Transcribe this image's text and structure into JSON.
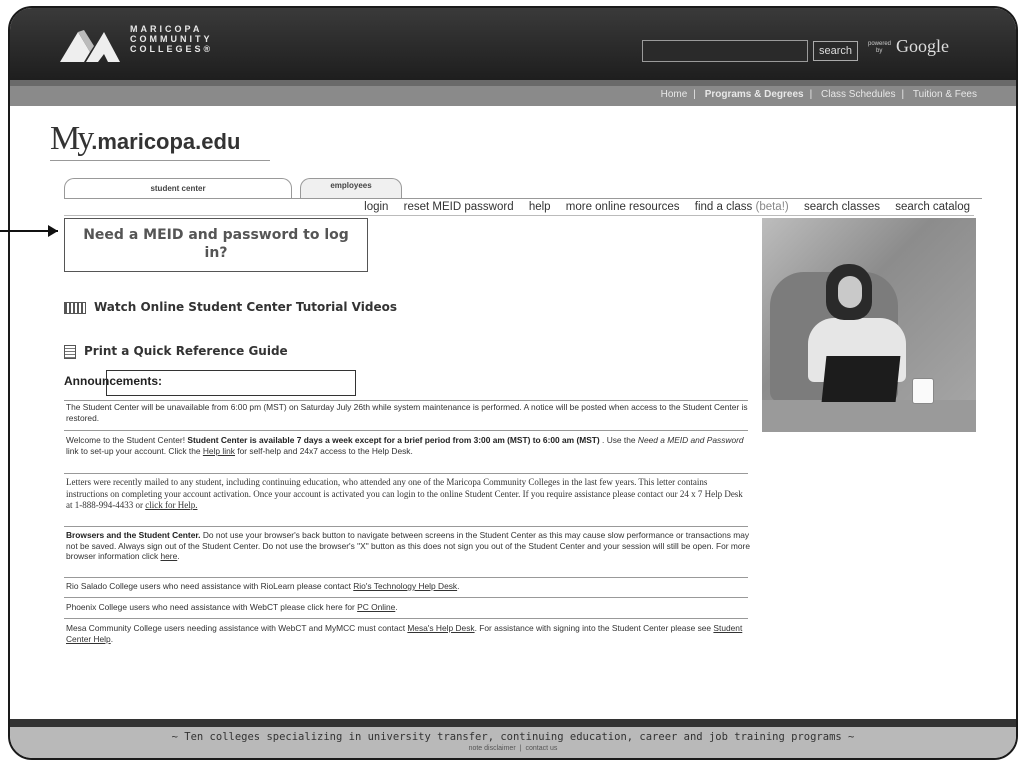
{
  "header": {
    "logo_lines": [
      "MARICOPA",
      "COMMUNITY",
      "COLLEGES®"
    ],
    "search_button": "search",
    "powered_by": [
      "powered",
      "by"
    ],
    "google": "Google"
  },
  "nav": {
    "items": [
      {
        "label": "Home",
        "bold": false
      },
      {
        "label": "Programs & Degrees",
        "bold": true
      },
      {
        "label": "Class Schedules",
        "bold": false
      },
      {
        "label": "Tuition & Fees",
        "bold": false
      }
    ],
    "separator": "|"
  },
  "brand": {
    "my": "My",
    "domain": ".maricopa.edu"
  },
  "tabs": {
    "student": "student center",
    "employees": "employees"
  },
  "sublinks": {
    "login": "login",
    "reset": "reset MEID password",
    "help": "help",
    "resources": "more online resources",
    "find_class": "find a class",
    "beta": "(beta!)",
    "search_classes": "search classes",
    "search_catalog": "search catalog"
  },
  "meid": {
    "line1": "Need a MEID and password to log",
    "line2": "in?"
  },
  "links": {
    "videos": "Watch Online Student Center Tutorial Videos",
    "guide": "Print a Quick Reference Guide"
  },
  "announcements": {
    "title": "Announcements:",
    "a1": "The Student Center will be unavailable from 6:00 pm (MST) on Saturday July 26th while system maintenance is performed.  A notice will be posted when access to the Student Center is restored.",
    "a2_pre": "Welcome to the Student Center! ",
    "a2_bold": "Student Center is available 7 days a week except for a brief period from 3:00 am (MST) to 6:00 am (MST)",
    "a2_mid": " . Use the ",
    "a2_italic": "Need a MEID and Password",
    "a2_mid2": " link to set-up your account. Click the ",
    "a2_link": "Help link",
    "a2_end": " for self-help and 24x7 access to the Help Desk.",
    "a3": "Letters were recently mailed to any student, including continuing education, who attended any one of the Maricopa Community Colleges in the last few years. This letter contains instructions on completing your account activation. Once your account is activated you can login to the online Student Center.  If you require assistance please contact our 24 x 7 Help Desk at 1-888-994-4433 or ",
    "a3_link": "click for Help.",
    "a4_bold": "Browsers and the Student Center.",
    "a4": " Do not use your browser's back button to navigate between screens in the Student Center as this may cause slow performance or transactions may not be saved.  Always sign out of the Student Center. Do not use the browser's \"X\" button as this does not sign you out of the Student Center and your session will still be open. For more browser information click ",
    "a4_link": "here",
    "a4_end": ".",
    "a5": "Rio Salado College users who need assistance with RioLearn please contact ",
    "a5_link": "Rio's Technology Help Desk",
    "a5_end": ".",
    "a6": "Phoenix College users who need assistance with WebCT please click here for ",
    "a6_link": "PC Online",
    "a6_end": ".",
    "a7": "Mesa Community College users needing assistance with WebCT and MyMCC must contact ",
    "a7_link": "Mesa's Help Desk",
    "a7_mid": ". For assistance with signing into the Student Center please see ",
    "a7_link2": "Student Center Help",
    "a7_end": "."
  },
  "footer": {
    "tagline": "~ Ten colleges specializing in university transfer, continuing education, career and job training programs ~",
    "disclaimer": "note disclaimer",
    "contact": "contact us"
  }
}
